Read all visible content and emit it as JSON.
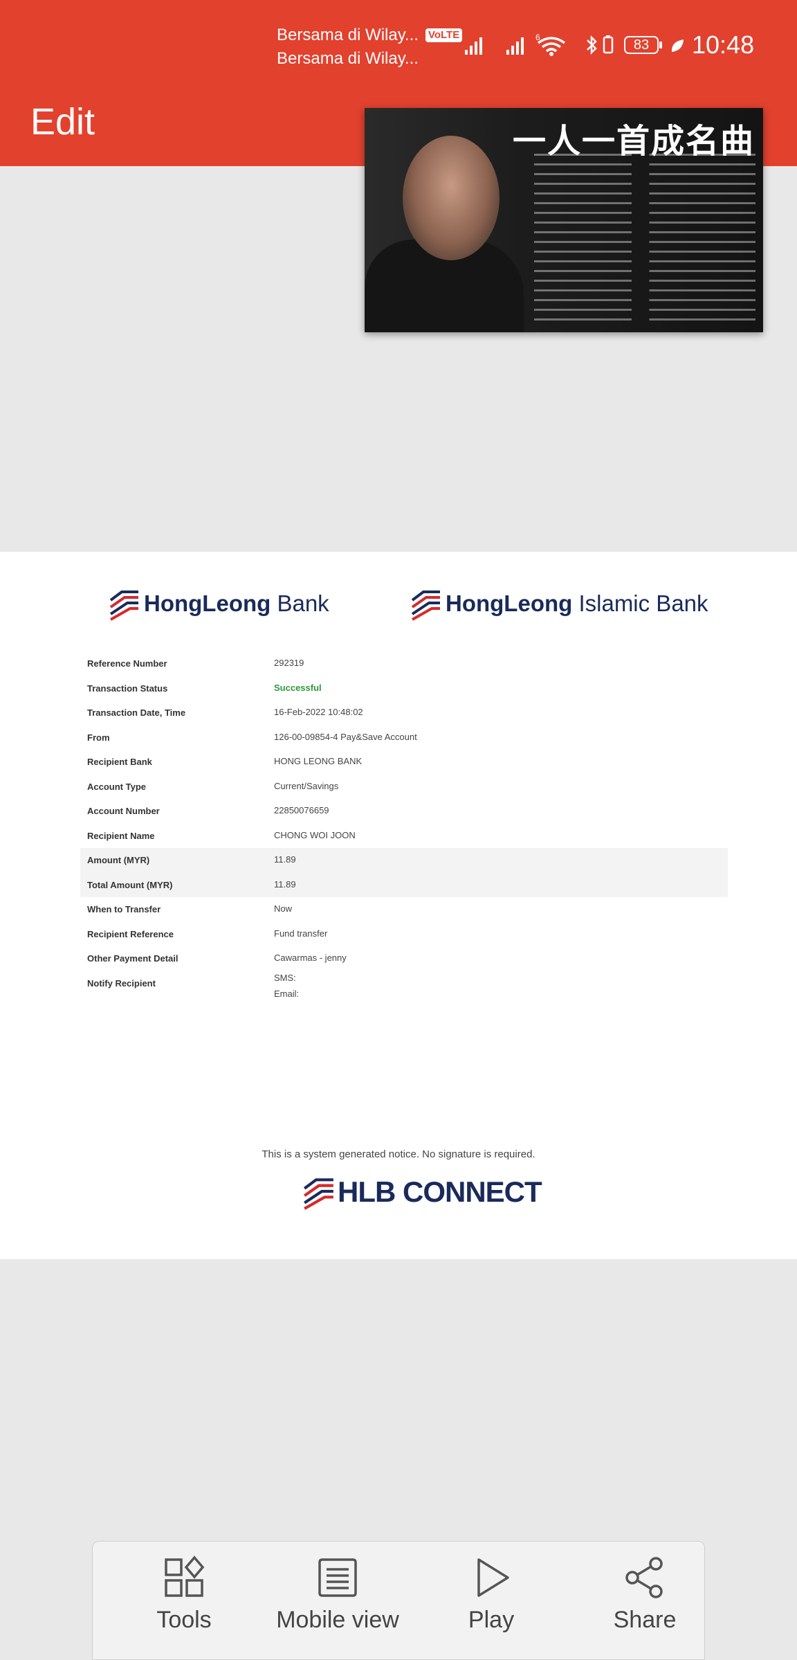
{
  "status_bar": {
    "carrier_1": "Bersama di Wilay...",
    "carrier_2": "Bersama di Wilay...",
    "volte": "VoLTE",
    "battery": "83",
    "time": "10:48"
  },
  "app_bar": {
    "title": "Edit"
  },
  "video_thumbnail": {
    "title": "一人一首成名曲"
  },
  "receipt": {
    "logos": {
      "bank_bold": "HongLeong",
      "bank_light": "Bank",
      "islamic_bold": "HongLeong",
      "islamic_light": "Islamic Bank"
    },
    "rows": [
      {
        "label": "Reference Number",
        "value": "292319"
      },
      {
        "label": "Transaction Status",
        "value": "Successful"
      },
      {
        "label": "Transaction Date, Time",
        "value": "16-Feb-2022 10:48:02"
      },
      {
        "label": "From",
        "value": "126-00-09854-4 Pay&Save Account"
      },
      {
        "label": "Recipient Bank",
        "value": "HONG LEONG BANK"
      },
      {
        "label": "Account Type",
        "value": "Current/Savings"
      },
      {
        "label": "Account Number",
        "value": "22850076659"
      },
      {
        "label": "Recipient Name",
        "value": "CHONG WOI JOON"
      },
      {
        "label": "Amount (MYR)",
        "value": "11.89"
      },
      {
        "label": "Total Amount (MYR)",
        "value": "11.89"
      },
      {
        "label": "When to Transfer",
        "value": "Now"
      },
      {
        "label": "Recipient Reference",
        "value": "Fund transfer"
      },
      {
        "label": "Other Payment Detail",
        "value": "Cawarmas - jenny"
      },
      {
        "label": "Notify Recipient",
        "value": "SMS:",
        "value2": "Email:"
      }
    ],
    "notice": "This is a system generated notice. No signature is required.",
    "footer_brand": "HLB CONNECT"
  },
  "toolbar": {
    "tools": "Tools",
    "mobile_view": "Mobile view",
    "play": "Play",
    "share": "Share"
  },
  "colors": {
    "brand_red": "#e2412e",
    "success_green": "#2a9a3a",
    "navy": "#1a2a5a"
  }
}
